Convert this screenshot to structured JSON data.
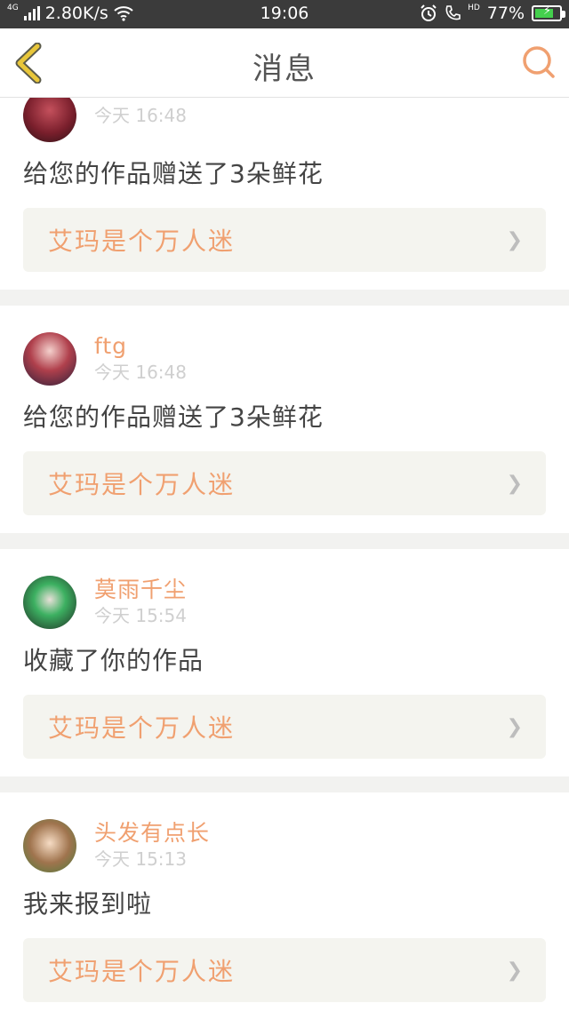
{
  "status_bar": {
    "network": "4G",
    "speed": "2.80K/s",
    "time": "19:06",
    "hd": "HD",
    "battery": "77%",
    "battery_level": 0.77
  },
  "header": {
    "title": "消息"
  },
  "colors": {
    "accent": "#f0a070",
    "back": "#e8c63a",
    "battery_green": "#44d04d"
  },
  "messages": [
    {
      "name": "",
      "time": "今天 16:48",
      "action": "给您的作品赠送了3朵鲜花",
      "work_title": "艾玛是个万人迷"
    },
    {
      "name": "ftg",
      "time": "今天 16:48",
      "action": "给您的作品赠送了3朵鲜花",
      "work_title": "艾玛是个万人迷"
    },
    {
      "name": "莫雨千尘",
      "time": "今天 15:54",
      "action": "收藏了你的作品",
      "work_title": "艾玛是个万人迷"
    },
    {
      "name": "头发有点长",
      "time": "今天 15:13",
      "action": "我来报到啦",
      "work_title": "艾玛是个万人迷"
    }
  ]
}
